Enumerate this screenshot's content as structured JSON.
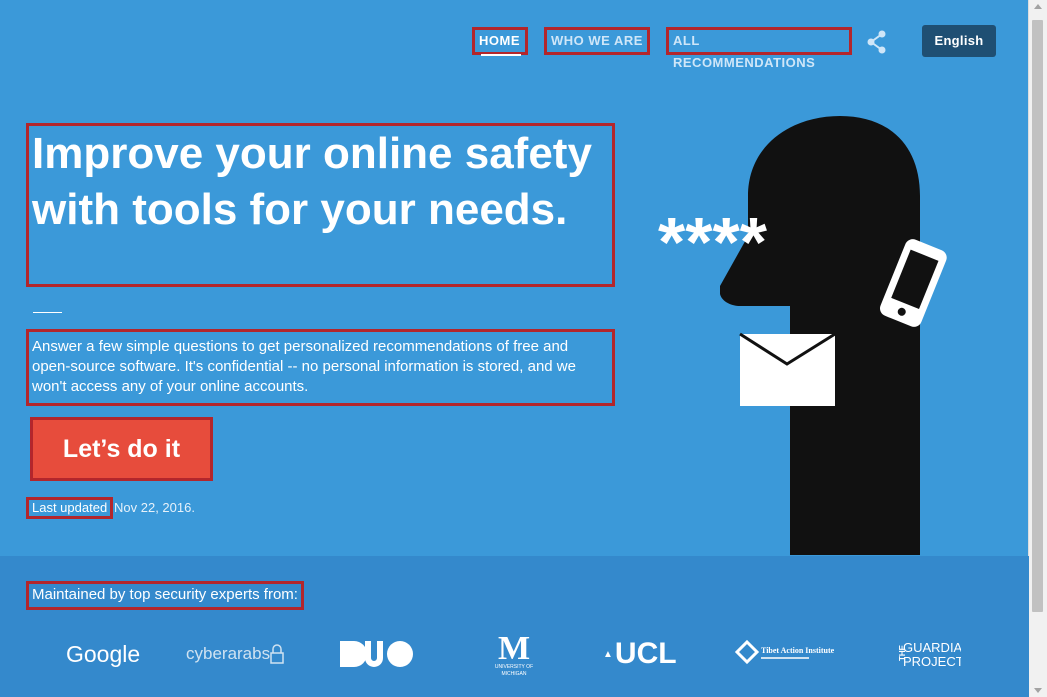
{
  "nav": {
    "items": [
      {
        "label": "HOME",
        "active": true
      },
      {
        "label": "WHO WE ARE",
        "active": false
      },
      {
        "label": "ALL RECOMMENDATIONS",
        "active": false
      }
    ],
    "share_icon": "share-icon",
    "language": "English"
  },
  "hero": {
    "title": "Improve your online safety with tools for your needs.",
    "subtitle": "Answer a few simple questions to get personalized recommendations of free and open-source software. It's confidential -- no personal information is stored, and we won't access any of your online accounts.",
    "cta_label": "Let’s do it",
    "last_updated_label": "Last updated",
    "last_updated_date": " Nov 22, 2016.",
    "illustration_text": "****"
  },
  "footer": {
    "maintained_label": "Maintained by top security experts from:",
    "logos": {
      "google": "Google",
      "cyberarabs": "cyberarabs",
      "duo": "DUO",
      "umich_letter": "M",
      "umich_caption_1": "UNIVERSITY OF",
      "umich_caption_2": "MICHIGAN",
      "ucl": "UCL",
      "tai": "Tibet Action Institute",
      "guardian_the": "THE",
      "guardian_1": "GUARDIAN",
      "guardian_2": "PROJECT"
    }
  },
  "colors": {
    "background": "#3b99d9",
    "footer_band": "#3489cc",
    "cta": "#e74c3c",
    "language_button": "#1f4f73",
    "highlight_outline": "#b3262c"
  }
}
